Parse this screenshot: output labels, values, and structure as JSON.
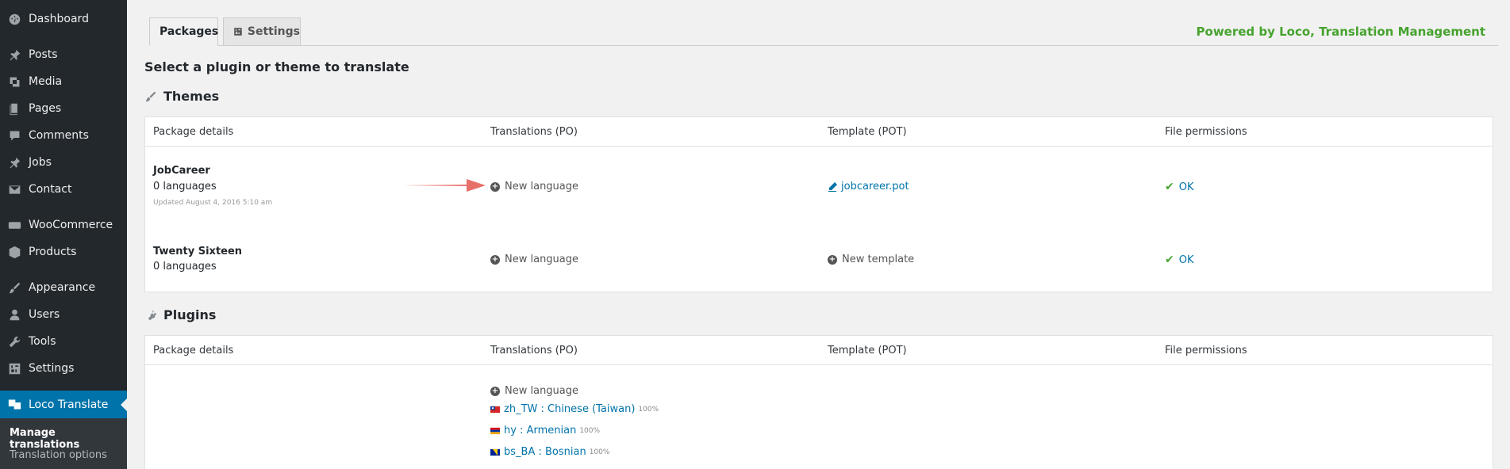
{
  "sidebar": {
    "items": [
      {
        "label": "Dashboard",
        "icon": "dashboard-icon"
      },
      {
        "label": "Posts",
        "icon": "pushpin-icon"
      },
      {
        "label": "Media",
        "icon": "media-icon"
      },
      {
        "label": "Pages",
        "icon": "pages-icon"
      },
      {
        "label": "Comments",
        "icon": "comment-icon"
      },
      {
        "label": "Jobs",
        "icon": "pushpin-icon"
      },
      {
        "label": "Contact",
        "icon": "envelope-icon"
      },
      {
        "label": "WooCommerce",
        "icon": "woocommerce-icon"
      },
      {
        "label": "Products",
        "icon": "box-icon"
      },
      {
        "label": "Appearance",
        "icon": "brush-icon"
      },
      {
        "label": "Users",
        "icon": "user-icon"
      },
      {
        "label": "Tools",
        "icon": "wrench-icon"
      },
      {
        "label": "Settings",
        "icon": "settings-icon"
      },
      {
        "label": "Loco Translate",
        "icon": "translate-icon"
      }
    ],
    "submenu": [
      "Manage translations",
      "Translation options"
    ]
  },
  "tabs": {
    "packages": "Packages",
    "settings": "Settings"
  },
  "powered_by": "Powered by Loco, Translation Management",
  "page_title": "Select a plugin or theme to translate",
  "themes": {
    "title": "Themes",
    "headers": [
      "Package details",
      "Translations (PO)",
      "Template (POT)",
      "File permissions"
    ],
    "rows": [
      {
        "name": "JobCareer",
        "languages": "0 languages",
        "updated": "Updated August 4, 2016 5:10 am",
        "translation_action": "New language",
        "template": "jobcareer.pot",
        "permissions": "OK"
      },
      {
        "name": "Twenty Sixteen",
        "languages": "0 languages",
        "translation_action": "New language",
        "template": "New template",
        "permissions": "OK"
      }
    ]
  },
  "plugins": {
    "title": "Plugins",
    "headers": [
      "Package details",
      "Translations (PO)",
      "Template (POT)",
      "File permissions"
    ],
    "new_language": "New language",
    "locales": [
      {
        "label": "zh_TW : Chinese (Taiwan)",
        "pct": "100%",
        "flag": "taiwan-flag"
      },
      {
        "label": "hy : Armenian",
        "pct": "100%",
        "flag": "armenia-flag"
      },
      {
        "label": "bs_BA : Bosnian",
        "pct": "100%",
        "flag": "bosnia-flag"
      }
    ]
  },
  "colors": {
    "sidebar_bg": "#23282d",
    "active": "#0073aa",
    "link": "#0073aa",
    "powered": "#46a32e",
    "arrow": "#e8706a"
  }
}
